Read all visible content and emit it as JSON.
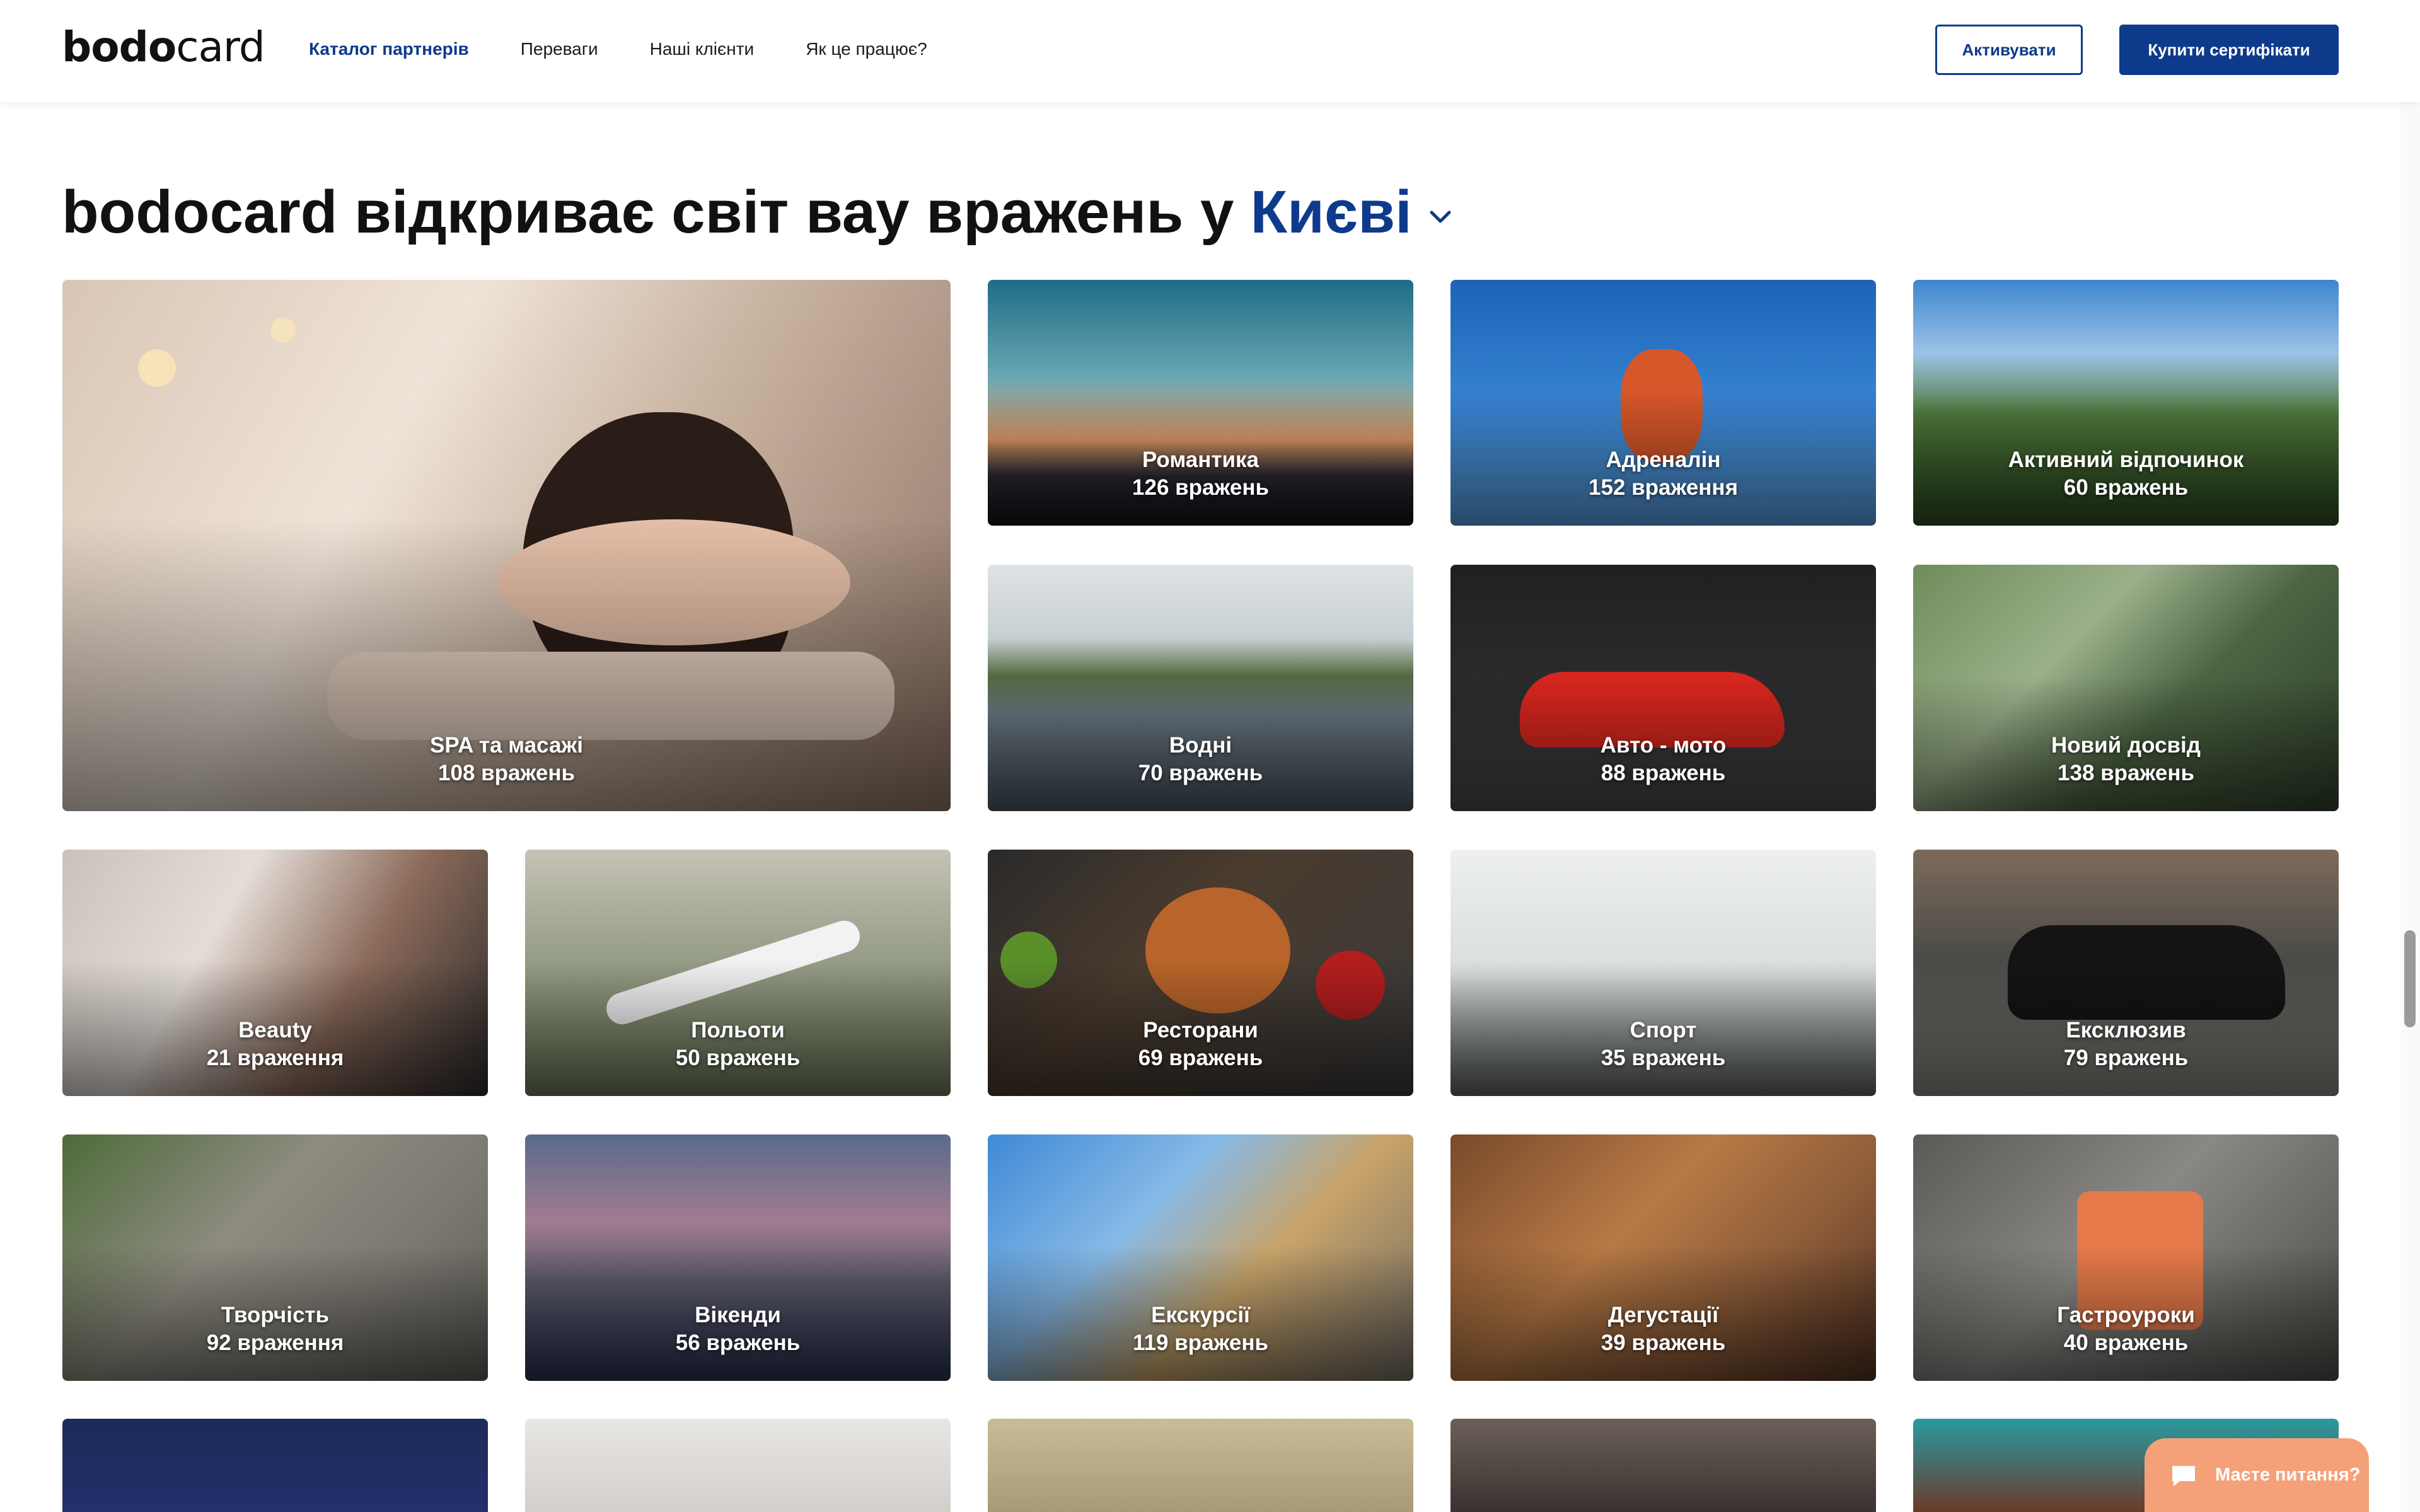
{
  "header": {
    "logo_bold": "bodo",
    "logo_regular": "card",
    "nav": [
      {
        "label": "Каталог партнерів",
        "active": true
      },
      {
        "label": "Переваги",
        "active": false
      },
      {
        "label": "Наші клієнти",
        "active": false
      },
      {
        "label": "Як це працює?",
        "active": false
      }
    ],
    "activate_label": "Активувати",
    "buy_label": "Купити сертифікати"
  },
  "main": {
    "title_prefix": "bodocard відкриває світ вау вражень у",
    "city": "Києві",
    "categories": [
      {
        "title": "SPA та масажі",
        "count": "108 вражень"
      },
      {
        "title": "Романтика",
        "count": "126 вражень"
      },
      {
        "title": "Адреналін",
        "count": "152 враження"
      },
      {
        "title": "Активний відпочинок",
        "count": "60 вражень"
      },
      {
        "title": "Водні",
        "count": "70 вражень"
      },
      {
        "title": "Авто - мото",
        "count": "88 вражень"
      },
      {
        "title": "Новий досвід",
        "count": "138 вражень"
      },
      {
        "title": "Beauty",
        "count": "21 враження"
      },
      {
        "title": "Польоти",
        "count": "50 вражень"
      },
      {
        "title": "Ресторани",
        "count": "69 вражень"
      },
      {
        "title": "Спорт",
        "count": "35 вражень"
      },
      {
        "title": "Ексклюзив",
        "count": "79 вражень"
      },
      {
        "title": "Творчість",
        "count": "92 враження"
      },
      {
        "title": "Вікенди",
        "count": "56 вражень"
      },
      {
        "title": "Екскурсії",
        "count": "119 вражень"
      },
      {
        "title": "Дегустації",
        "count": "39 вражень"
      },
      {
        "title": "Гастроуроки",
        "count": "40 вражень"
      },
      {
        "title": "",
        "count": ""
      },
      {
        "title": "",
        "count": ""
      },
      {
        "title": "",
        "count": ""
      },
      {
        "title": "",
        "count": ""
      },
      {
        "title": "",
        "count": ""
      }
    ]
  },
  "chat": {
    "label": "Маєте питання?"
  },
  "colors": {
    "brand": "#0e3a8c",
    "chat": "#f4a17a"
  }
}
